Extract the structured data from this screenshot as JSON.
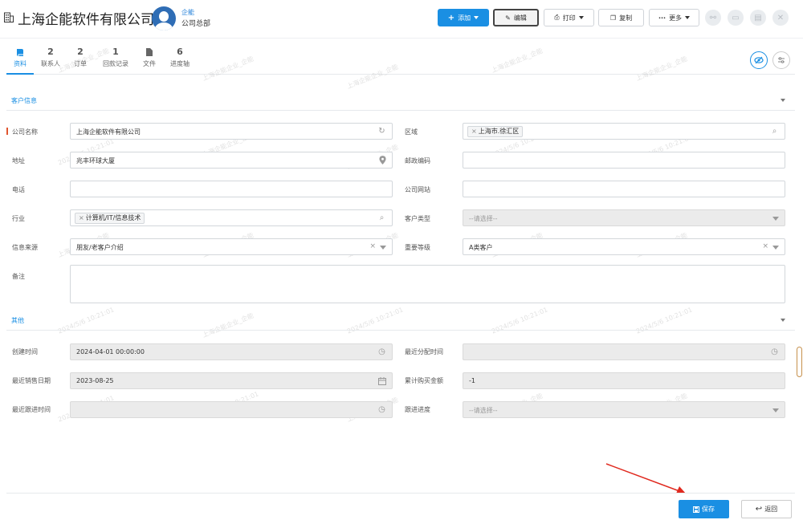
{
  "header": {
    "company_title": "上海企能软件有限公司",
    "user_name": "企能",
    "user_dept": "公司总部"
  },
  "toolbar": {
    "add": "添加",
    "edit": "编辑",
    "print": "打印",
    "copy": "复制",
    "more": "更多"
  },
  "tabs": [
    {
      "num": "",
      "label": "资料"
    },
    {
      "num": "2",
      "label": "联系人"
    },
    {
      "num": "2",
      "label": "订单"
    },
    {
      "num": "1",
      "label": "回款记录"
    },
    {
      "num": "",
      "label": "文件"
    },
    {
      "num": "6",
      "label": "进度轴"
    }
  ],
  "sections": {
    "customer_info": "客户信息",
    "other": "其他"
  },
  "form": {
    "company_name": {
      "label": "公司名称",
      "value": "上海企能软件有限公司"
    },
    "region": {
      "label": "区域",
      "tag": "上海市.徐汇区"
    },
    "address": {
      "label": "地址",
      "value": "兆丰环球大厦"
    },
    "postcode": {
      "label": "邮政编码",
      "value": ""
    },
    "phone": {
      "label": "电话",
      "value": ""
    },
    "website": {
      "label": "公司网站",
      "value": ""
    },
    "industry": {
      "label": "行业",
      "tag": "计算机/IT/信息技术"
    },
    "customer_type": {
      "label": "客户类型",
      "placeholder": "--请选择--"
    },
    "source": {
      "label": "信息来源",
      "value": "朋友/老客户介绍"
    },
    "importance": {
      "label": "重要等级",
      "value": "A类客户"
    },
    "remark": {
      "label": "备注",
      "value": ""
    }
  },
  "other": {
    "created_time": {
      "label": "创建时间",
      "value": "2024-04-01 00:00:00"
    },
    "last_assign_time": {
      "label": "最近分配时间",
      "value": ""
    },
    "last_sale_date": {
      "label": "最近销售日期",
      "value": "2023-08-25"
    },
    "total_purchase": {
      "label": "累计购买金额",
      "value": "-1"
    },
    "last_follow_time": {
      "label": "最近跟进时间",
      "value": ""
    },
    "follow_progress": {
      "label": "跟进进度",
      "placeholder": "--请选择--"
    }
  },
  "watermark": {
    "company": "上海企能企业_企能",
    "timestamp": "2024/5/6 10:21:01"
  },
  "footer": {
    "save": "保存",
    "back": "返回"
  },
  "colors": {
    "primary": "#1a8fe3",
    "required": "#e0562f",
    "arrow": "#e0291e"
  }
}
